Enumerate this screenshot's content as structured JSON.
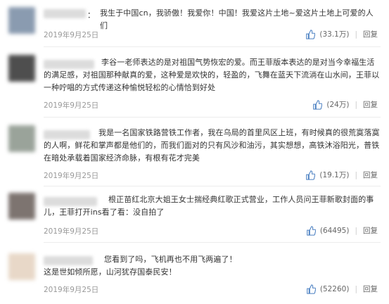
{
  "comments": [
    {
      "text": "我生于中国cn，我骄傲！我爱你！中国！我爱这片土地~爱这片土地上可爱的人们",
      "date": "2019年9月25日",
      "likes": "(33.1万)",
      "reply": "回复",
      "avatar_color": "#8a9bb0"
    },
    {
      "text": "李谷一老师表达的是对祖国气势恢宏的爱。而王菲版本表达的是对当今幸福生活的满足感，对祖国那种献真的爱，这种爱是欢快的，轻盈的，飞舞在蓝天下流淌在山水间，王菲以一种咛唱的方式传递这种愉悦轻松的心情恰到好处",
      "date": "2019年9月25日",
      "likes": "(24万)",
      "reply": "回复",
      "avatar_color": "#5a5a5a"
    },
    {
      "text": "我是一名国家铁路营铁工作者，我在乌局的首里风区上班，有时候真的很荒寞落寞的人啊，鲜花和掌声都是他们的，而我们面对的只有风沙和油污，其实想想，高铁沐浴阳光，普铁在暗处承载着国家经济命脉，有根有花才完美",
      "date": "2019年9月25日",
      "likes": "(19.1万)",
      "reply": "回复",
      "avatar_color": "#9aa39a"
    },
    {
      "text": "根正苗红北京大姐王女士揣经典红歌正式营业，工作人员问王菲新歌封面的事儿，王菲打开ins看了看：没自拍了",
      "date": "2019年9月25日",
      "likes": "(64495)",
      "reply": "回复",
      "avatar_color": "#7d7470"
    },
    {
      "text": "您看到了吗，飞机再也不用飞两遍了！",
      "text2": "这是世如倾所愿，山河犹存国泰民安！",
      "date": "2019年9月25日",
      "likes": "(52260)",
      "reply": "回复",
      "avatar_color": "#e8d8c8"
    }
  ]
}
